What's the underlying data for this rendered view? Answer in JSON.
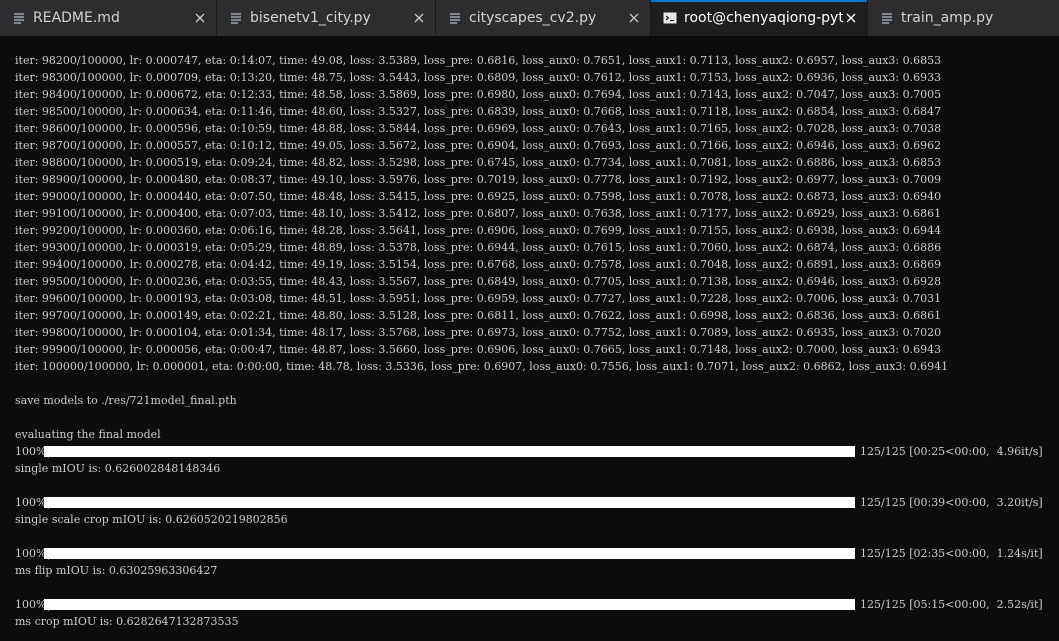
{
  "tabs": [
    {
      "label": "README.md",
      "icon": "file-doc-icon",
      "active": false
    },
    {
      "label": "bisenetv1_city.py",
      "icon": "file-doc-icon",
      "active": false
    },
    {
      "label": "cityscapes_cv2.py",
      "icon": "file-doc-icon",
      "active": false
    },
    {
      "label": "root@chenyaqiong-pytorch",
      "icon": "terminal-icon",
      "active": true
    },
    {
      "label": "train_amp.py",
      "icon": "file-doc-icon",
      "active": false
    }
  ],
  "terminal": {
    "iter_lines": [
      "iter: 98200/100000, lr: 0.000747, eta: 0:14:07, time: 49.08, loss: 3.5389, loss_pre: 0.6816, loss_aux0: 0.7651, loss_aux1: 0.7113, loss_aux2: 0.6957, loss_aux3: 0.6853",
      "iter: 98300/100000, lr: 0.000709, eta: 0:13:20, time: 48.75, loss: 3.5443, loss_pre: 0.6809, loss_aux0: 0.7612, loss_aux1: 0.7153, loss_aux2: 0.6936, loss_aux3: 0.6933",
      "iter: 98400/100000, lr: 0.000672, eta: 0:12:33, time: 48.58, loss: 3.5869, loss_pre: 0.6980, loss_aux0: 0.7694, loss_aux1: 0.7143, loss_aux2: 0.7047, loss_aux3: 0.7005",
      "iter: 98500/100000, lr: 0.000634, eta: 0:11:46, time: 48.60, loss: 3.5327, loss_pre: 0.6839, loss_aux0: 0.7668, loss_aux1: 0.7118, loss_aux2: 0.6854, loss_aux3: 0.6847",
      "iter: 98600/100000, lr: 0.000596, eta: 0:10:59, time: 48.88, loss: 3.5844, loss_pre: 0.6969, loss_aux0: 0.7643, loss_aux1: 0.7165, loss_aux2: 0.7028, loss_aux3: 0.7038",
      "iter: 98700/100000, lr: 0.000557, eta: 0:10:12, time: 49.05, loss: 3.5672, loss_pre: 0.6904, loss_aux0: 0.7693, loss_aux1: 0.7166, loss_aux2: 0.6946, loss_aux3: 0.6962",
      "iter: 98800/100000, lr: 0.000519, eta: 0:09:24, time: 48.82, loss: 3.5298, loss_pre: 0.6745, loss_aux0: 0.7734, loss_aux1: 0.7081, loss_aux2: 0.6886, loss_aux3: 0.6853",
      "iter: 98900/100000, lr: 0.000480, eta: 0:08:37, time: 49.10, loss: 3.5976, loss_pre: 0.7019, loss_aux0: 0.7778, loss_aux1: 0.7192, loss_aux2: 0.6977, loss_aux3: 0.7009",
      "iter: 99000/100000, lr: 0.000440, eta: 0:07:50, time: 48.48, loss: 3.5415, loss_pre: 0.6925, loss_aux0: 0.7598, loss_aux1: 0.7078, loss_aux2: 0.6873, loss_aux3: 0.6940",
      "iter: 99100/100000, lr: 0.000400, eta: 0:07:03, time: 48.10, loss: 3.5412, loss_pre: 0.6807, loss_aux0: 0.7638, loss_aux1: 0.7177, loss_aux2: 0.6929, loss_aux3: 0.6861",
      "iter: 99200/100000, lr: 0.000360, eta: 0:06:16, time: 48.28, loss: 3.5641, loss_pre: 0.6906, loss_aux0: 0.7699, loss_aux1: 0.7155, loss_aux2: 0.6938, loss_aux3: 0.6944",
      "iter: 99300/100000, lr: 0.000319, eta: 0:05:29, time: 48.89, loss: 3.5378, loss_pre: 0.6944, loss_aux0: 0.7615, loss_aux1: 0.7060, loss_aux2: 0.6874, loss_aux3: 0.6886",
      "iter: 99400/100000, lr: 0.000278, eta: 0:04:42, time: 49.19, loss: 3.5154, loss_pre: 0.6768, loss_aux0: 0.7578, loss_aux1: 0.7048, loss_aux2: 0.6891, loss_aux3: 0.6869",
      "iter: 99500/100000, lr: 0.000236, eta: 0:03:55, time: 48.43, loss: 3.5567, loss_pre: 0.6849, loss_aux0: 0.7705, loss_aux1: 0.7138, loss_aux2: 0.6946, loss_aux3: 0.6928",
      "iter: 99600/100000, lr: 0.000193, eta: 0:03:08, time: 48.51, loss: 3.5951, loss_pre: 0.6959, loss_aux0: 0.7727, loss_aux1: 0.7228, loss_aux2: 0.7006, loss_aux3: 0.7031",
      "iter: 99700/100000, lr: 0.000149, eta: 0:02:21, time: 48.80, loss: 3.5128, loss_pre: 0.6811, loss_aux0: 0.7622, loss_aux1: 0.6998, loss_aux2: 0.6836, loss_aux3: 0.6861",
      "iter: 99800/100000, lr: 0.000104, eta: 0:01:34, time: 48.17, loss: 3.5768, loss_pre: 0.6973, loss_aux0: 0.7752, loss_aux1: 0.7089, loss_aux2: 0.6935, loss_aux3: 0.7020",
      "iter: 99900/100000, lr: 0.000056, eta: 0:00:47, time: 48.87, loss: 3.5660, loss_pre: 0.6906, loss_aux0: 0.7665, loss_aux1: 0.7148, loss_aux2: 0.7000, loss_aux3: 0.6943",
      "iter: 100000/100000, lr: 0.000001, eta: 0:00:00, time: 48.78, loss: 3.5336, loss_pre: 0.6907, loss_aux0: 0.7556, loss_aux1: 0.7071, loss_aux2: 0.6862, loss_aux3: 0.6941"
    ],
    "save_line": "save models to ./res/721model_final.pth",
    "eval_header": "evaluating the final model",
    "evals": [
      {
        "percent_text": "100%|",
        "progress": 1.0,
        "stats": "125/125 [00:25<00:00,  4.96it/s]",
        "result": "single mIOU is: 0.626002848148346"
      },
      {
        "percent_text": "100%|",
        "progress": 1.0,
        "stats": "125/125 [00:39<00:00,  3.20it/s]",
        "result": "single scale crop mIOU is: 0.6260520219802856"
      },
      {
        "percent_text": "100%|",
        "progress": 1.0,
        "stats": "125/125 [02:35<00:00,  1.24s/it]",
        "result": "ms flip mIOU is: 0.63025963306427"
      },
      {
        "percent_text": "100%|",
        "progress": 1.0,
        "stats": "125/125 [05:15<00:00,  2.52s/it]",
        "result": "ms crop mIOU is: 0.6282647132873535"
      }
    ]
  },
  "colors": {
    "accent": "#0078d4",
    "terminal_bg": "#0c0c0c",
    "terminal_text": "#cccccc",
    "tab_bg": "#2d2d30"
  }
}
